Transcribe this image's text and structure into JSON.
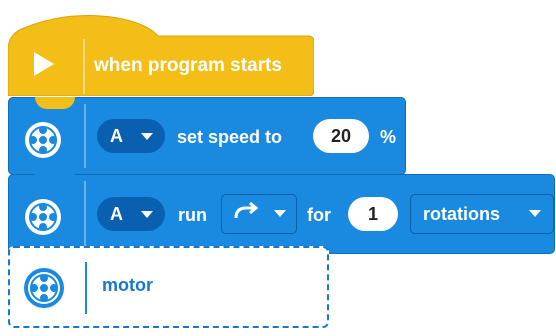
{
  "colors": {
    "event_yellow": "#f3be17",
    "motor_blue": "#1a8ae0",
    "dark_pill": "#0a60b0",
    "ghost_blue": "#1a78c8"
  },
  "hat_block": {
    "label": "when program starts",
    "icon": "play-icon"
  },
  "set_speed_block": {
    "icon": "motor-icon",
    "port": "A",
    "label": "set speed to",
    "value": "20",
    "unit": "%"
  },
  "run_block": {
    "icon": "motor-icon",
    "port": "A",
    "label": "run",
    "direction_icon": "clockwise-arrow-icon",
    "for_label": "for",
    "value": "1",
    "unit": "rotations"
  },
  "palette_ghost": {
    "icon": "motor-icon",
    "label": "motor"
  }
}
